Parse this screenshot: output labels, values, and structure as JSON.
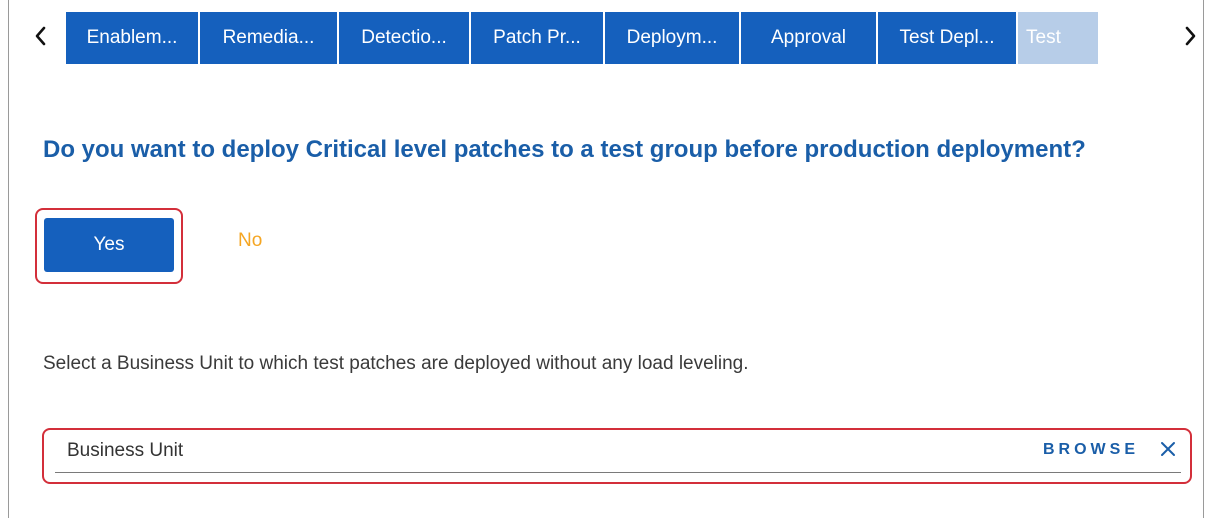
{
  "tabs": [
    {
      "label": "Enablem..."
    },
    {
      "label": "Remedia..."
    },
    {
      "label": "Detectio..."
    },
    {
      "label": "Patch Pr..."
    },
    {
      "label": "Deploym..."
    },
    {
      "label": "Approval"
    },
    {
      "label": "Test Depl..."
    },
    {
      "label": "Test"
    }
  ],
  "question": "Do you want to deploy Critical level patches to a test group before production deployment?",
  "choices": {
    "yes": "Yes",
    "no": "No"
  },
  "description": "Select a Business Unit to which test patches are deployed without any load leveling.",
  "business_unit": {
    "placeholder": "Business Unit",
    "value": "",
    "browse_label": "BROWSE"
  },
  "icons": {
    "prev": "chevron-left-icon",
    "next": "chevron-right-icon",
    "clear": "close-icon"
  },
  "colors": {
    "primary": "#1560bd",
    "tab_inactive_light": "#b7cde8",
    "heading": "#1a5ea8",
    "no_option": "#f5a623",
    "highlight_border": "#d32f3a"
  }
}
